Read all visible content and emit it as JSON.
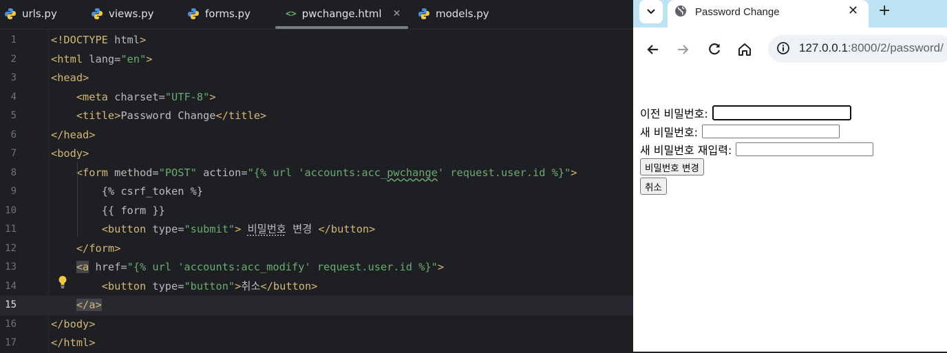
{
  "ide": {
    "tabs": [
      {
        "label": "urls.py",
        "kind": "python"
      },
      {
        "label": "views.py",
        "kind": "python"
      },
      {
        "label": "forms.py",
        "kind": "python"
      },
      {
        "label": "pwchange.html",
        "kind": "html",
        "active": true
      },
      {
        "label": "models.py",
        "kind": "python"
      }
    ],
    "current_line": 15,
    "lines": [
      "1",
      "2",
      "3",
      "4",
      "5",
      "6",
      "7",
      "8",
      "9",
      "10",
      "11",
      "12",
      "13",
      "14",
      "15",
      "16",
      "17"
    ]
  },
  "browser": {
    "tab_title": "Password Change",
    "url_host": "127.0.0.1",
    "url_rest": ":8000/2/password/",
    "form": {
      "old_password_label": "이전 비밀번호:",
      "new_password_label": "새 비밀번호:",
      "confirm_password_label": "새 비밀번호 재입력:",
      "submit_label": "비밀번호 변경",
      "cancel_label": "취소"
    }
  },
  "colors": {
    "ide_bg": "#1e1f22",
    "tag": "#d5b778",
    "string": "#6aab73",
    "browser_tabstrip": "#bde3f3"
  }
}
